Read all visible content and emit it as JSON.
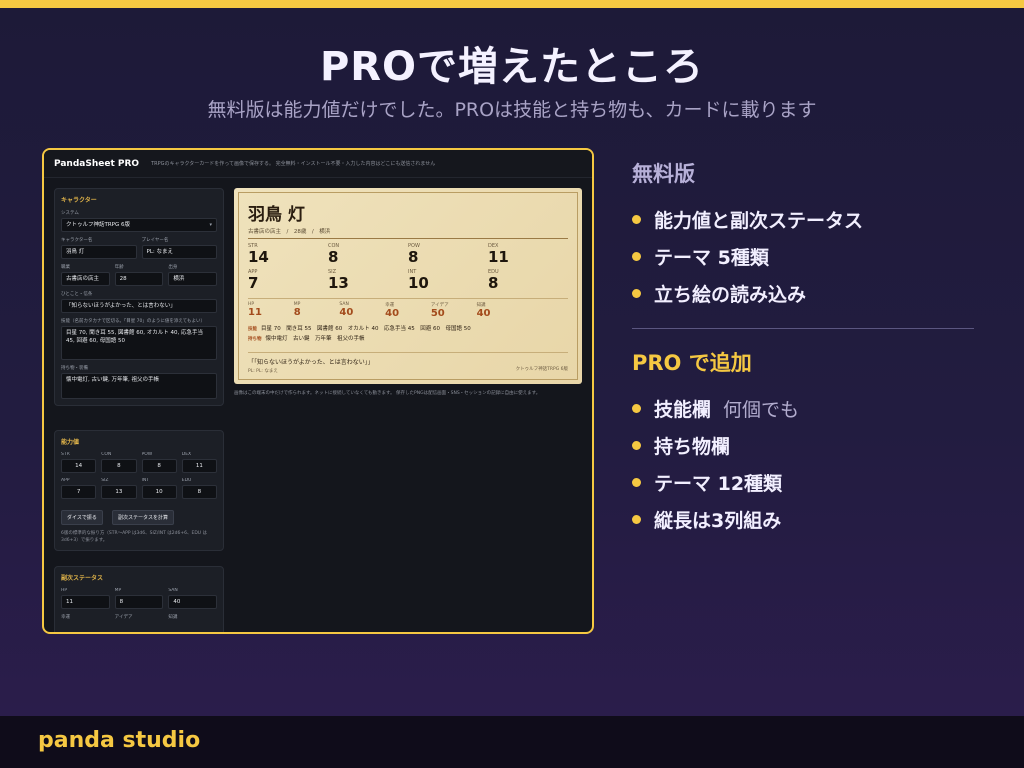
{
  "slide": {
    "title": "PROで増えたところ",
    "subtitle": "無料版は能力値だけでした。PROは技能と持ち物も、カードに載ります",
    "brand": "panda studio"
  },
  "app": {
    "title": "PandaSheet PRO",
    "description": "TRPGのキャラクターカードを作って画像で保存する。 完全無料・インストール不要・入力した内容はどこにも送信されません",
    "character_panel": {
      "title": "キャラクター",
      "system_label": "システム",
      "system_value": "クトゥルフ神話TRPG 6版",
      "name_label": "キャラクター名",
      "name_value": "羽鳥 灯",
      "player_label": "プレイヤー名",
      "player_placeholder": "PL: なまえ",
      "job_label": "職業",
      "job_value": "古書店の店主",
      "age_label": "年齢",
      "age_value": "28",
      "origin_label": "出身",
      "origin_value": "横浜",
      "quote_label": "ひとこと・信条",
      "quote_value": "「知らないほうがよかった、とは言わない」",
      "skills_label": "技能（名前カタカナで区切る。「目星 70」のように値を添えてもよい）",
      "skills_value": "目星 70, 聞き耳 55, 図書館 60, オカルト 40, 応急手当 45, 回避 60, 母国語 50",
      "items_label": "持ち物・装備",
      "items_value": "懐中電灯, 古い鍵, 万年筆, 祖父の手帳"
    },
    "stats_panel": {
      "title": "能力値",
      "stats": [
        {
          "label": "STR",
          "value": "14"
        },
        {
          "label": "CON",
          "value": "8"
        },
        {
          "label": "POW",
          "value": "8"
        },
        {
          "label": "DEX",
          "value": "11"
        },
        {
          "label": "APP",
          "value": "7"
        },
        {
          "label": "SIZ",
          "value": "13"
        },
        {
          "label": "INT",
          "value": "10"
        },
        {
          "label": "EDU",
          "value": "8"
        }
      ],
      "roll_button": "ダイスで振る",
      "calc_button": "副次ステータスを計算",
      "note": "6版の標準的な振り方（STR〜APP は3d6、SIZ/INT は2d6+6、EDU は3d6+3）で振ります。"
    },
    "derived_panel": {
      "title": "副次ステータス",
      "stats": [
        {
          "label": "HP",
          "value": "11"
        },
        {
          "label": "MP",
          "value": "8"
        },
        {
          "label": "SAN",
          "value": "40"
        }
      ],
      "more_labels": [
        "幸運",
        "アイデア",
        "知識"
      ]
    },
    "card": {
      "name": "羽鳥 灯",
      "sub": "古書店の店主　/　28歳　/　横浜",
      "stats": [
        {
          "label": "STR",
          "value": "14"
        },
        {
          "label": "CON",
          "value": "8"
        },
        {
          "label": "POW",
          "value": "8"
        },
        {
          "label": "DEX",
          "value": "11"
        },
        {
          "label": "APP",
          "value": "7"
        },
        {
          "label": "SIZ",
          "value": "13"
        },
        {
          "label": "INT",
          "value": "10"
        },
        {
          "label": "EDU",
          "value": "8"
        }
      ],
      "derived": [
        {
          "label": "HP",
          "value": "11"
        },
        {
          "label": "MP",
          "value": "8"
        },
        {
          "label": "SAN",
          "value": "40"
        },
        {
          "label": "幸運",
          "value": "40"
        },
        {
          "label": "アイデア",
          "value": "50"
        },
        {
          "label": "知識",
          "value": "40"
        }
      ],
      "skills_key": "技能",
      "skills_text": "目星 70　聞き耳 55　図書館 60　オカルト 40　応急手当 45　回避 60　母国語 50",
      "items_key": "持ち物",
      "items_text": "懐中電灯　古い鍵　万年筆　祖父の手帳",
      "quote": "「「知らないほうがよかった、とは言わない」」",
      "player": "PL: PL: なまえ",
      "system": "クトゥルフ神話TRPG 6版"
    },
    "card_note": "画像はこの端末の中だけで作られます。ネットに接続していなくても動きます。 保存したPNGは配信画面・SNS・セッションの記録に自由に使えます。"
  },
  "features": {
    "free_heading": "無料版",
    "free_items": [
      "能力値と副次ステータス",
      "テーマ 5種類",
      "立ち絵の読み込み"
    ],
    "pro_heading": "PRO で追加",
    "pro_items": [
      {
        "label": "技能欄",
        "note": "何個でも"
      },
      {
        "label": "持ち物欄",
        "note": ""
      },
      {
        "label": "テーマ 12種類",
        "note": ""
      },
      {
        "label": "縦長は3列組み",
        "note": ""
      }
    ]
  },
  "colors": {
    "accent": "#f5c842",
    "background": "#1d1a38",
    "card": "#efe2bc",
    "card_accent": "#a34b1c"
  }
}
